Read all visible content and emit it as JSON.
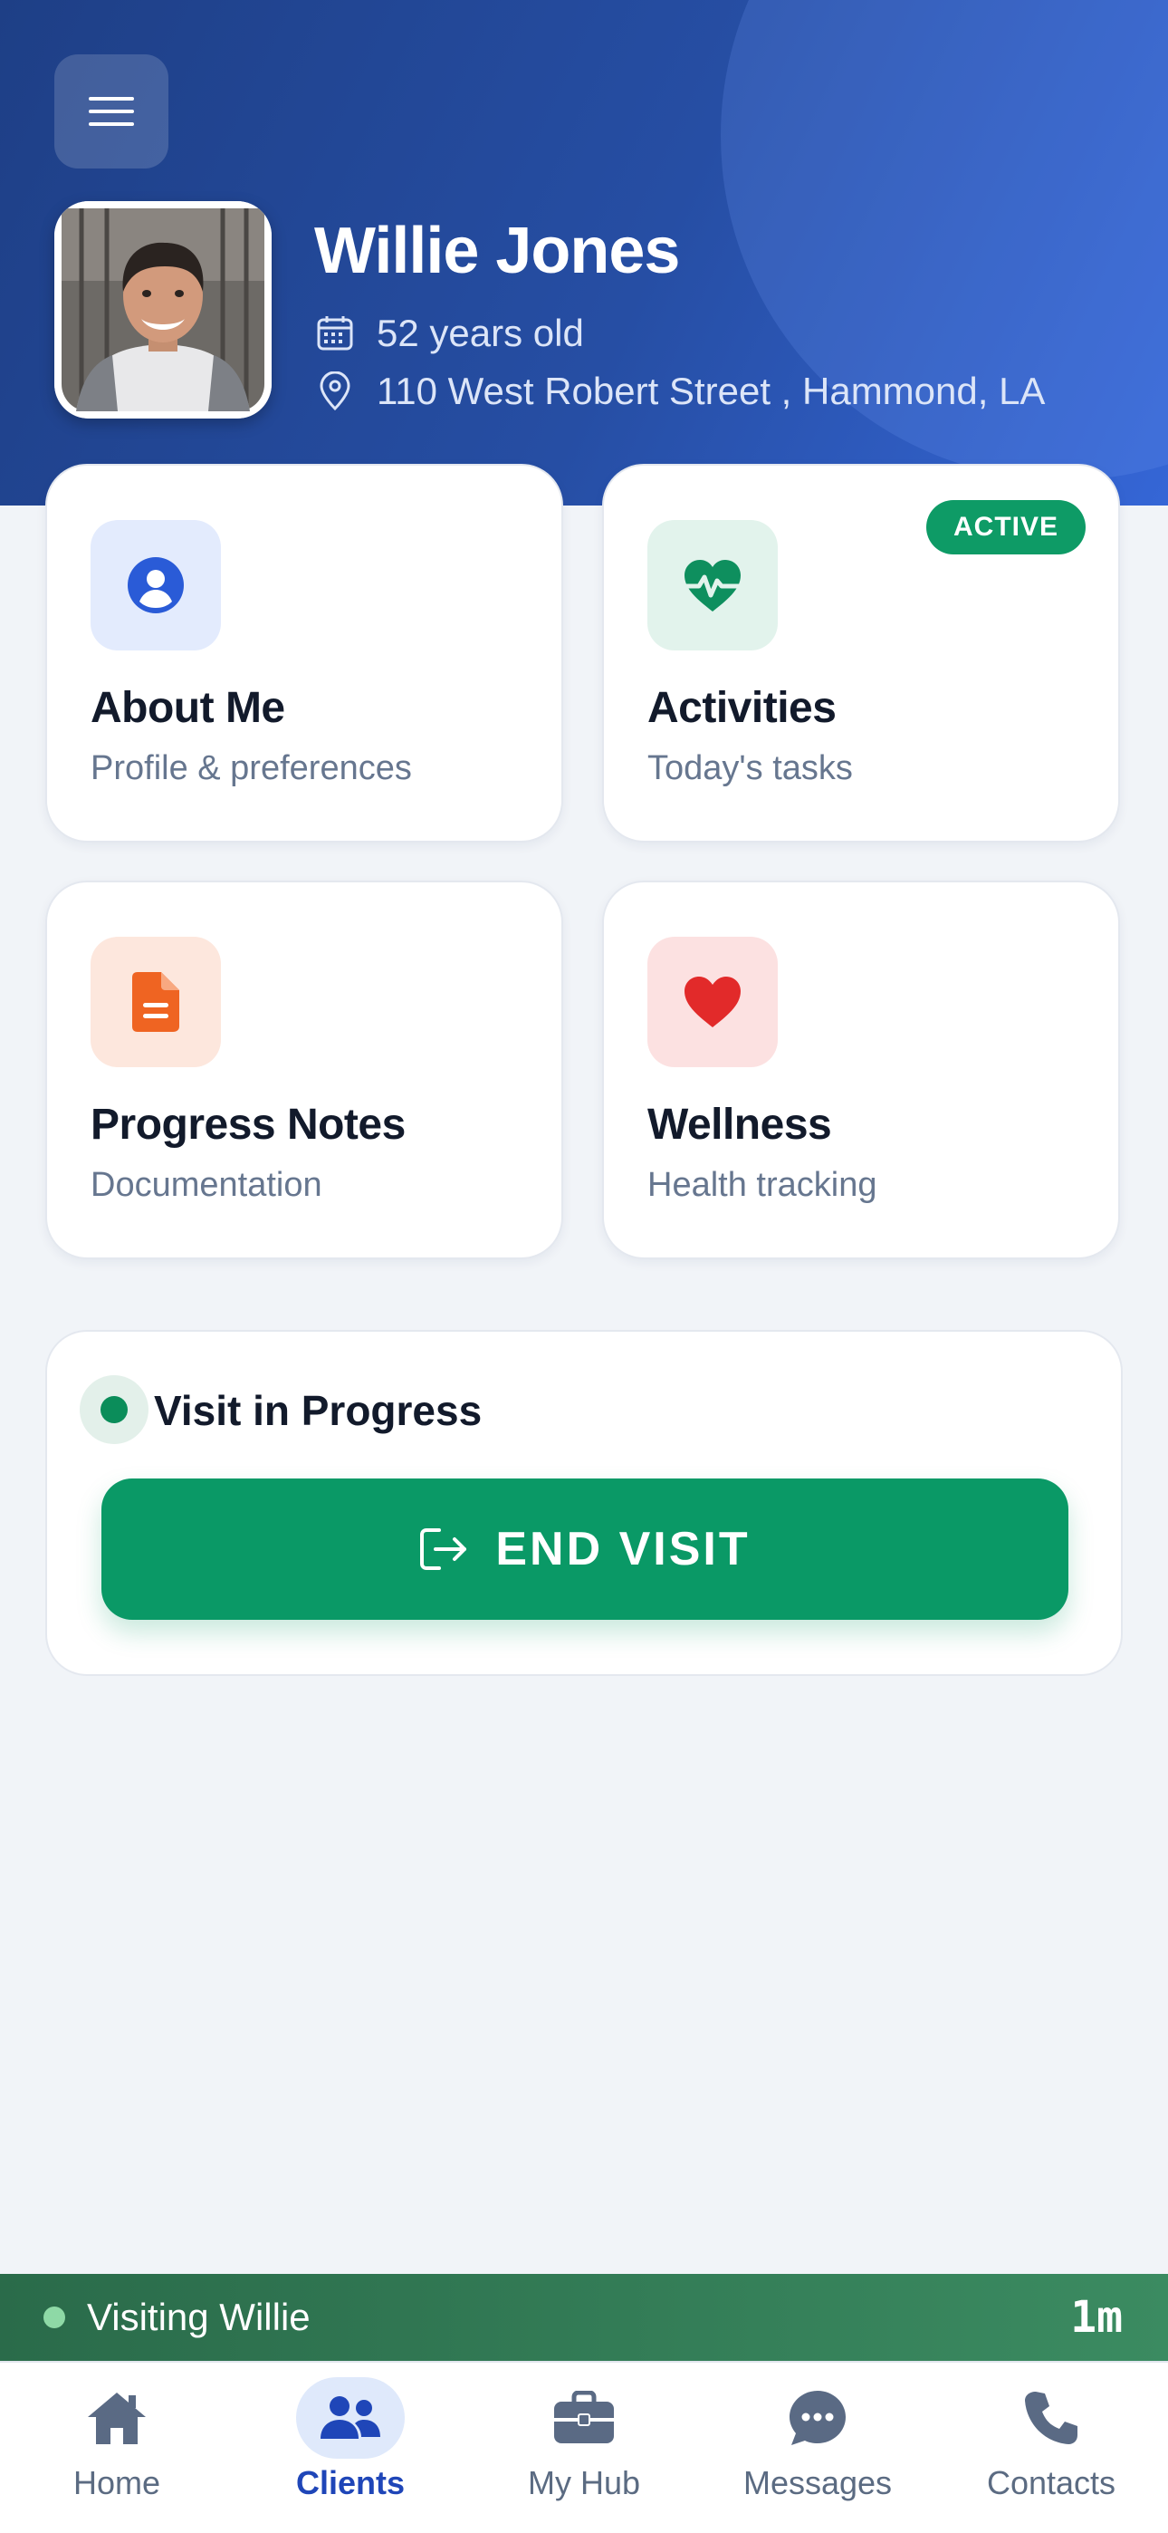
{
  "header": {
    "client_name": "Willie Jones",
    "age": "52 years old",
    "address": "110 West Robert Street , Hammond, LA"
  },
  "cards": [
    {
      "title": "About Me",
      "subtitle": "Profile & preferences",
      "icon": "user-circle-icon",
      "tile_color": "#e3ebfd",
      "icon_color": "#2a5bd7"
    },
    {
      "title": "Activities",
      "subtitle": "Today's tasks",
      "badge": "ACTIVE",
      "icon": "heart-pulse-icon",
      "tile_color": "#e2f3ec",
      "icon_color": "#0e8f5e"
    },
    {
      "title": "Progress Notes",
      "subtitle": "Documentation",
      "icon": "document-icon",
      "tile_color": "#fde7dd",
      "icon_color": "#ef6422"
    },
    {
      "title": "Wellness",
      "subtitle": "Health tracking",
      "icon": "heart-icon",
      "tile_color": "#fce1e1",
      "icon_color": "#e22a2a"
    }
  ],
  "visit": {
    "status": "Visit in Progress",
    "end_label": "END VISIT"
  },
  "visit_bar": {
    "label": "Visiting Willie",
    "timer": "1m"
  },
  "tabbar": {
    "active": "Clients",
    "tabs": [
      {
        "label": "Home",
        "icon": "home-icon"
      },
      {
        "label": "Clients",
        "icon": "users-icon"
      },
      {
        "label": "My Hub",
        "icon": "briefcase-icon"
      },
      {
        "label": "Messages",
        "icon": "chat-bubble-icon"
      },
      {
        "label": "Contacts",
        "icon": "phone-icon"
      }
    ]
  },
  "colors": {
    "header_gradient_start": "#1e3f86",
    "header_gradient_end": "#3566d6",
    "primary_green": "#0a9966",
    "active_tab": "#1f46b8",
    "page_background": "#f1f4f8"
  }
}
